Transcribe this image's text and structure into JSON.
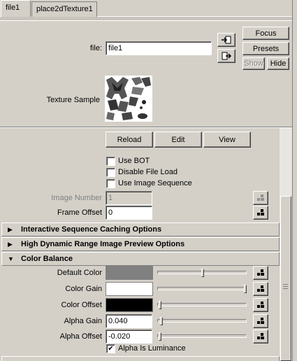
{
  "tabs": [
    {
      "label": "file1",
      "active": true
    },
    {
      "label": "place2dTexture1",
      "active": false
    }
  ],
  "file": {
    "label": "file:",
    "value": "file1"
  },
  "buttons": {
    "focus": "Focus",
    "presets": "Presets",
    "show": "Show",
    "hide": "Hide"
  },
  "texture_sample": {
    "label": "Texture Sample"
  },
  "actions": {
    "reload": "Reload",
    "edit": "Edit",
    "view": "View"
  },
  "checkboxes": [
    {
      "label": "Use BOT",
      "checked": false
    },
    {
      "label": "Disable File Load",
      "checked": false
    },
    {
      "label": "Use Image Sequence",
      "checked": false
    }
  ],
  "image_number": {
    "label": "Image Number",
    "value": "1"
  },
  "frame_offset": {
    "label": "Frame Offset",
    "value": "0"
  },
  "sections": {
    "caching": "Interactive Sequence Caching Options",
    "hdr": "High Dynamic Range Image Preview Options",
    "color_balance": "Color Balance"
  },
  "color_balance": {
    "default_color": {
      "label": "Default Color",
      "color": "#808080",
      "level": 0.5
    },
    "color_gain": {
      "label": "Color Gain",
      "color": "#ffffff",
      "level": 1.0
    },
    "color_offset": {
      "label": "Color Offset",
      "color": "#000000",
      "level": 0.0
    },
    "alpha_gain": {
      "label": "Alpha Gain",
      "value": "0.040",
      "level": 0.02
    },
    "alpha_offset": {
      "label": "Alpha Offset",
      "value": "-0.020",
      "level": 0.0
    },
    "alpha_is_luminance": {
      "label": "Alpha Is Luminance",
      "checked": true
    }
  },
  "icons": {
    "load": "load-file-icon",
    "export": "export-file-icon",
    "map": "map-checker-icon"
  }
}
